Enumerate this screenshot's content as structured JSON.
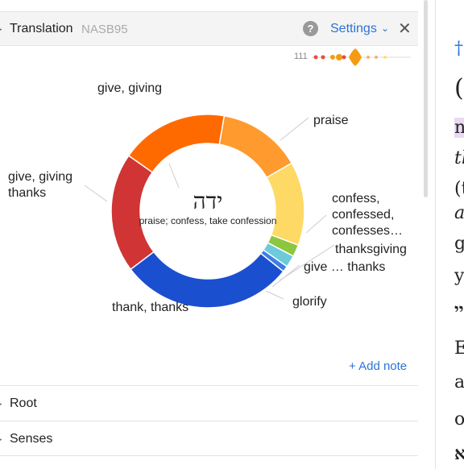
{
  "header": {
    "title": "Translation",
    "version": "NASB95",
    "help_symbol": "?",
    "settings_label": "Settings",
    "chevron_symbol": "⌄",
    "close_symbol": "✕",
    "caret_symbol": "▸"
  },
  "mini_chart": {
    "count": "111",
    "colors": [
      "#e74c3c",
      "#f39c12",
      "#ffd966"
    ]
  },
  "center": {
    "hebrew": "ידה",
    "gloss": "praise; confess, take confession"
  },
  "chart_data": {
    "type": "pie",
    "donut": true,
    "slices": [
      {
        "label": "give, giving thanks",
        "value": 20,
        "color": "#d03434"
      },
      {
        "label": "give, giving",
        "value": 18,
        "color": "#ff6a00"
      },
      {
        "label": "praise",
        "value": 14,
        "color": "#ff9a2e"
      },
      {
        "label": "confess, confessed, confesses…",
        "value": 14,
        "color": "#ffd966"
      },
      {
        "label": "thanksgiving",
        "value": 2,
        "color": "#8dc63f"
      },
      {
        "label": "give … thanks",
        "value": 2,
        "color": "#6ccad9"
      },
      {
        "label": "glorify",
        "value": 1,
        "color": "#3d7ee6"
      },
      {
        "label": "thank, thanks",
        "value": 29,
        "color": "#1a4fcf"
      }
    ]
  },
  "labels": {
    "give_giving": "give, giving",
    "praise": "praise",
    "give_thanks_line1": "give, giving",
    "give_thanks_line2": "thanks",
    "confess_line1": "confess,",
    "confess_line2": "confessed,",
    "confess_line3": "confesses…",
    "thanksgiving": "thanksgiving",
    "give_dots_thanks": "give … thanks",
    "glorify": "glorify",
    "thank_thanks": "thank, thanks"
  },
  "add_note_label": "+ Add note",
  "sections": [
    {
      "label": "Root"
    },
    {
      "label": "Senses"
    }
  ],
  "right_pane": {
    "fragments": [
      "†",
      "(",
      "n",
      "th",
      "(t",
      "a",
      "g",
      "y",
      "יי",
      "E",
      "al",
      "o",
      "א"
    ]
  },
  "colors": {
    "accent": "#2b74d6",
    "highlight": "#ead9f2"
  }
}
